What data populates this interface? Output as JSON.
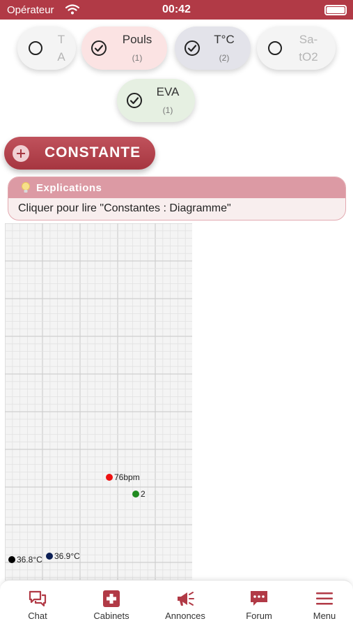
{
  "status_bar": {
    "carrier": "Opérateur",
    "time": "00:42"
  },
  "filters": [
    {
      "label": "T A",
      "count": "",
      "selected": false,
      "bg": "#f4f4f4",
      "lines": [
        "T",
        "A"
      ]
    },
    {
      "label": "Pouls",
      "count": "(1)",
      "selected": true,
      "bg": "#fbe3e3"
    },
    {
      "label": "T°C",
      "count": "(2)",
      "selected": true,
      "bg": "#e3e3ea"
    },
    {
      "label": "Sa- tO2",
      "count": "",
      "selected": false,
      "bg": "#f4f4f4",
      "lines": [
        "Sa-",
        "tO2"
      ]
    },
    {
      "label": "EVA",
      "count": "(1)",
      "selected": true,
      "bg": "#e6f0e2"
    }
  ],
  "constante_button": {
    "label": "CONSTANTE"
  },
  "explanation": {
    "title": "Explications",
    "text": "Cliquer pour lire \"Constantes : Diagramme\""
  },
  "chart_data": {
    "type": "scatter",
    "points": [
      {
        "label": "76bpm",
        "color": "#ee1111",
        "series": "Pouls"
      },
      {
        "label": "2",
        "color": "#1f8a1f",
        "series": "EVA"
      },
      {
        "label": "36.9°C",
        "color": "#0c1f55",
        "series": "T°C"
      },
      {
        "label": "36.8°C",
        "color": "#000000",
        "series": "T°C"
      }
    ],
    "grid": true
  },
  "bottom_nav": [
    {
      "label": "Chat",
      "icon": "chat-icon"
    },
    {
      "label": "Cabinets",
      "icon": "medical-cross-icon"
    },
    {
      "label": "Annonces",
      "icon": "megaphone-icon"
    },
    {
      "label": "Forum",
      "icon": "forum-icon"
    },
    {
      "label": "Menu",
      "icon": "menu-icon"
    }
  ],
  "colors": {
    "brand": "#b13a46",
    "accent_light": "#dc9aa4"
  }
}
